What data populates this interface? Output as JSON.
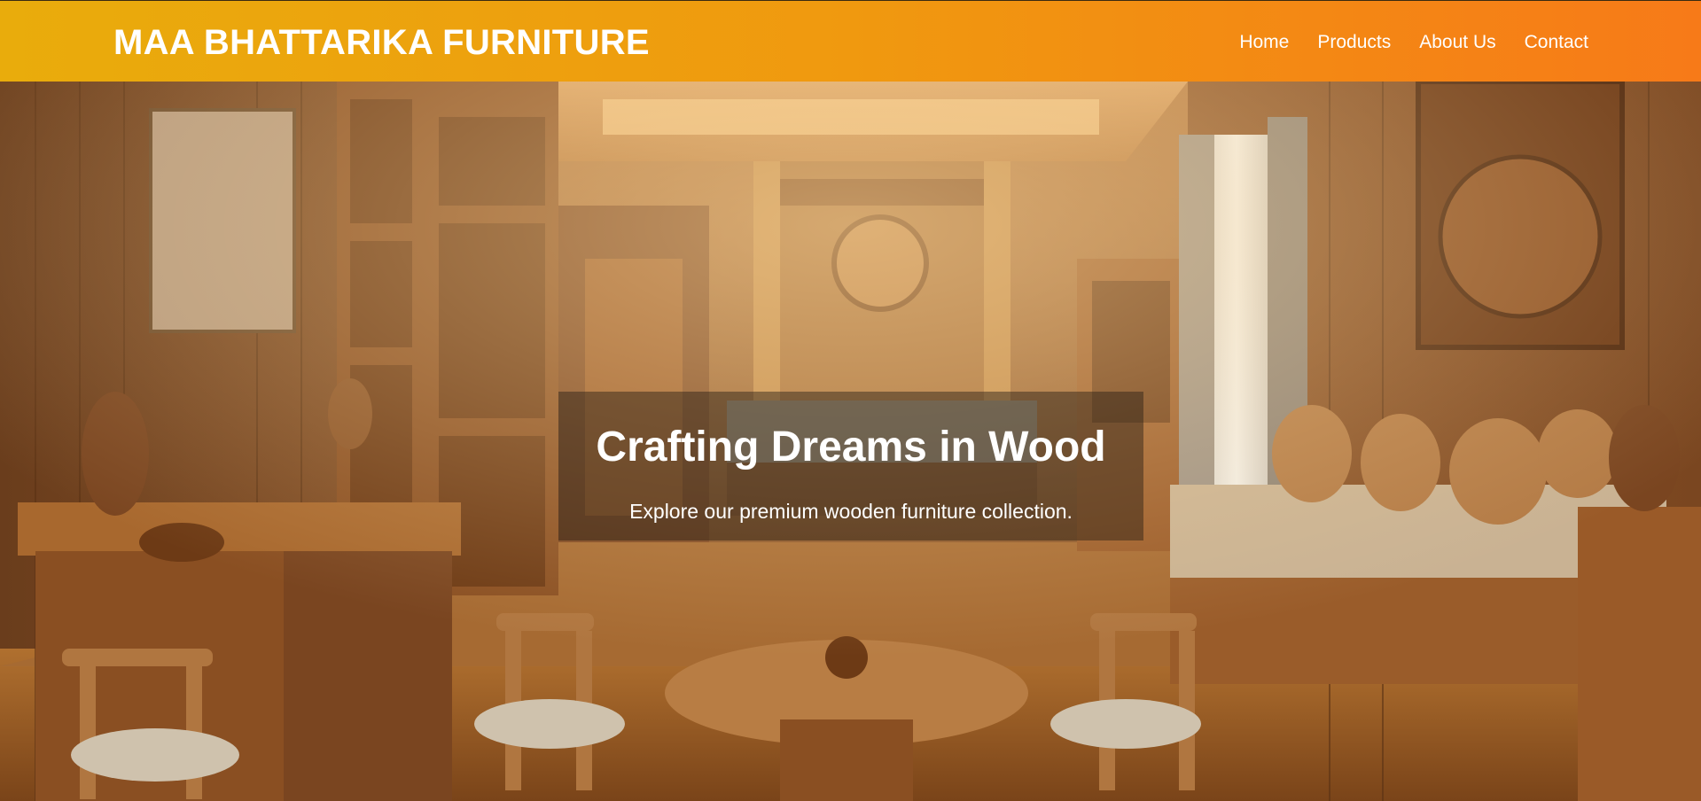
{
  "header": {
    "brand": "MAA BHATTARIKA FURNITURE",
    "nav": [
      {
        "label": "Home"
      },
      {
        "label": "Products"
      },
      {
        "label": "About Us"
      },
      {
        "label": "Contact"
      }
    ]
  },
  "hero": {
    "title": "Crafting Dreams in Wood",
    "subtitle": "Explore our premium wooden furniture collection."
  },
  "colors": {
    "header_gradient_start": "#e9ac0c",
    "header_gradient_end": "#f77a18",
    "text": "#ffffff"
  }
}
